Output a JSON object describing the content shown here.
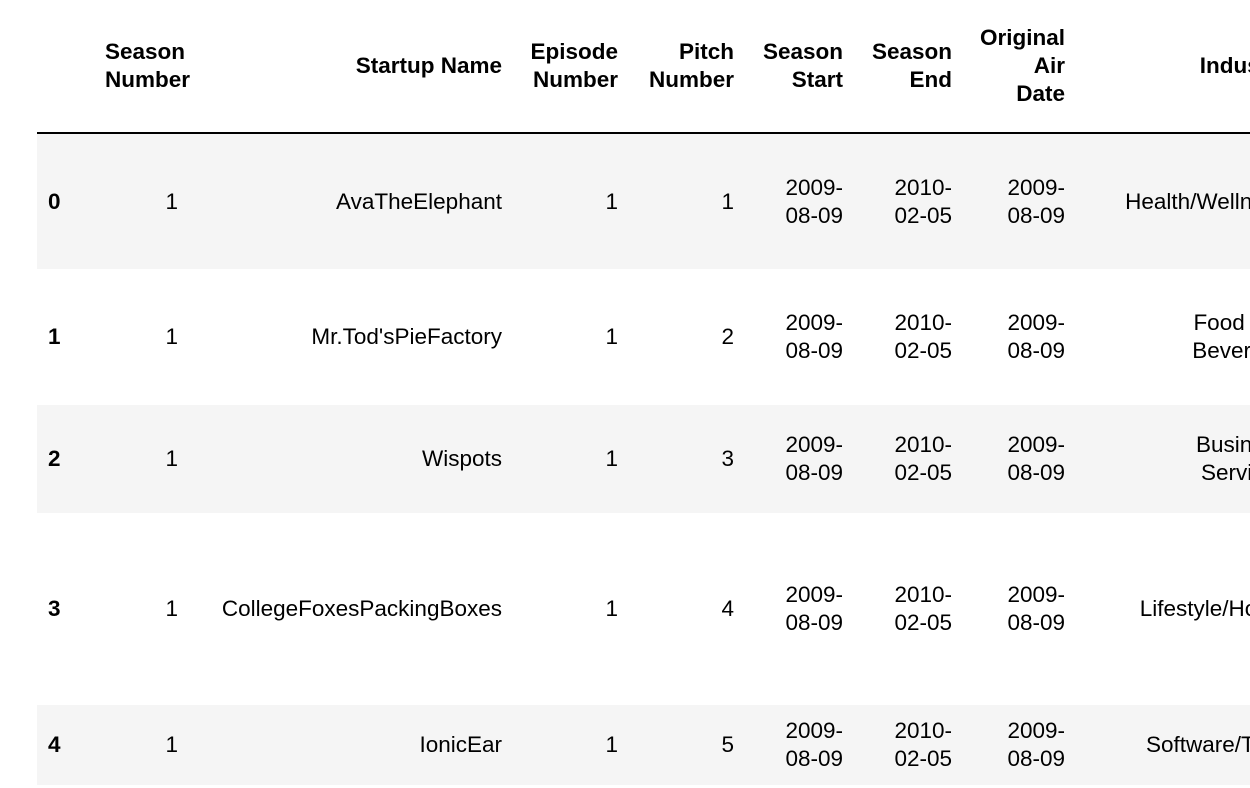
{
  "table": {
    "columns": [
      "",
      "Season Number",
      "Startup Name",
      "Episode Number",
      "Pitch Number",
      "Season Start",
      "Season End",
      "Original Air Date",
      "Industry"
    ],
    "header_lines": [
      [
        ""
      ],
      [
        "Season",
        "Number"
      ],
      [
        "Startup Name"
      ],
      [
        "Episode",
        "Number"
      ],
      [
        "Pitch",
        "Number"
      ],
      [
        "Season",
        "Start"
      ],
      [
        "Season",
        "End"
      ],
      [
        "Original",
        "Air",
        "Date"
      ],
      [
        "Industr"
      ]
    ],
    "rows": [
      {
        "index": "0",
        "season_number": "1",
        "startup_name": "AvaTheElephant",
        "episode_number": "1",
        "pitch_number": "1",
        "season_start": [
          "2009-",
          "08-09"
        ],
        "season_end": [
          "2010-",
          "02-05"
        ],
        "original_air_date": [
          "2009-",
          "08-09"
        ],
        "industry": [
          "Health/Wellnes"
        ]
      },
      {
        "index": "1",
        "season_number": "1",
        "startup_name": "Mr.Tod'sPieFactory",
        "episode_number": "1",
        "pitch_number": "2",
        "season_start": [
          "2009-",
          "08-09"
        ],
        "season_end": [
          "2010-",
          "02-05"
        ],
        "original_air_date": [
          "2009-",
          "08-09"
        ],
        "industry": [
          "Food an",
          "Beverag"
        ]
      },
      {
        "index": "2",
        "season_number": "1",
        "startup_name": "Wispots",
        "episode_number": "1",
        "pitch_number": "3",
        "season_start": [
          "2009-",
          "08-09"
        ],
        "season_end": [
          "2010-",
          "02-05"
        ],
        "original_air_date": [
          "2009-",
          "08-09"
        ],
        "industry": [
          "Busines",
          "Service"
        ]
      },
      {
        "index": "3",
        "season_number": "1",
        "startup_name": "CollegeFoxesPackingBoxes",
        "episode_number": "1",
        "pitch_number": "4",
        "season_start": [
          "2009-",
          "08-09"
        ],
        "season_end": [
          "2010-",
          "02-05"
        ],
        "original_air_date": [
          "2009-",
          "08-09"
        ],
        "industry": [
          "Lifestyle/Hom"
        ]
      },
      {
        "index": "4",
        "season_number": "1",
        "startup_name": "IonicEar",
        "episode_number": "1",
        "pitch_number": "5",
        "season_start": [
          "2009-",
          "08-09"
        ],
        "season_end": [
          "2010-",
          "02-05"
        ],
        "original_air_date": [
          "2009-",
          "08-09"
        ],
        "industry": [
          "Software/Tec"
        ]
      }
    ]
  }
}
